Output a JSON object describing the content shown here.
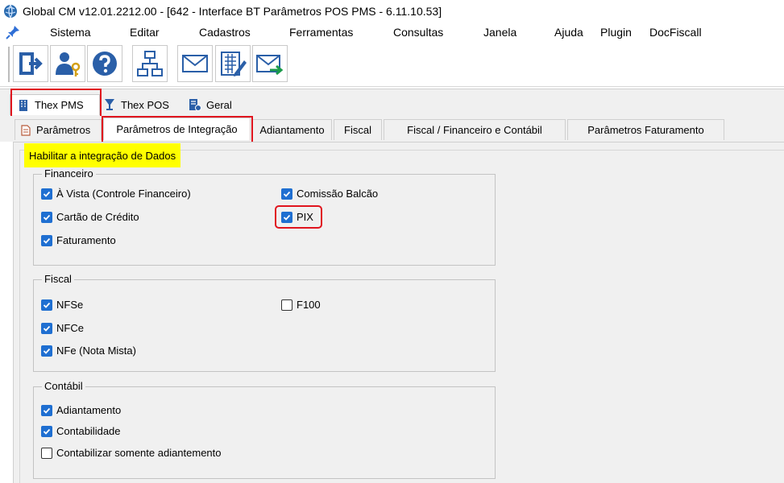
{
  "window": {
    "title": "Global CM v12.01.2212.00 - [642 - Interface BT Parâmetros POS PMS - 6.11.10.53]"
  },
  "menu": [
    "Sistema",
    "Editar",
    "Cadastros",
    "Ferramentas",
    "Consultas",
    "Janela",
    "Ajuda",
    "Plugin",
    "DocFiscall"
  ],
  "toolbar": {
    "icons": [
      "exit-icon",
      "user-key-icon",
      "help-icon",
      "network-icon",
      "mail-icon",
      "edit-sheet-icon",
      "mail-forward-icon"
    ]
  },
  "outer_tabs": [
    {
      "label": "Thex PMS",
      "icon": "building-icon",
      "active": true
    },
    {
      "label": "Thex POS",
      "icon": "glass-icon",
      "active": false
    },
    {
      "label": "Geral",
      "icon": "settings-icon",
      "active": false
    }
  ],
  "inner_tabs": [
    {
      "label": "Parâmetros",
      "active": false
    },
    {
      "label": "Parâmetros de Integração",
      "active": true
    },
    {
      "label": "Adiantamento",
      "active": false
    },
    {
      "label": "Fiscal",
      "active": false
    },
    {
      "label": "Fiscal / Financeiro e Contábil",
      "active": false
    },
    {
      "label": "Parâmetros Faturamento",
      "active": false
    }
  ],
  "section_title": "Habilitar a integração de Dados",
  "groups": {
    "financeiro": {
      "label": "Financeiro",
      "items": [
        {
          "label": "À Vista (Controle Financeiro)",
          "checked": true
        },
        {
          "label": "Cartão de Crédito",
          "checked": true
        },
        {
          "label": "Faturamento",
          "checked": true
        },
        {
          "label": "Comissão Balcão",
          "checked": true
        },
        {
          "label": "PIX",
          "checked": true
        }
      ]
    },
    "fiscal": {
      "label": "Fiscal",
      "items": [
        {
          "label": "NFSe",
          "checked": true
        },
        {
          "label": "NFCe",
          "checked": true
        },
        {
          "label": "NFe (Nota Mista)",
          "checked": true
        },
        {
          "label": "F100",
          "checked": false
        }
      ]
    },
    "contabil": {
      "label": "Contábil",
      "items": [
        {
          "label": "Adiantamento",
          "checked": true
        },
        {
          "label": "Contabilidade",
          "checked": true
        },
        {
          "label": "Contabilizar somente adiantemento",
          "checked": false
        }
      ]
    }
  },
  "colors": {
    "highlight": "#ffff00",
    "annotation": "#e0141e",
    "checkbox": "#1f6fd1"
  }
}
